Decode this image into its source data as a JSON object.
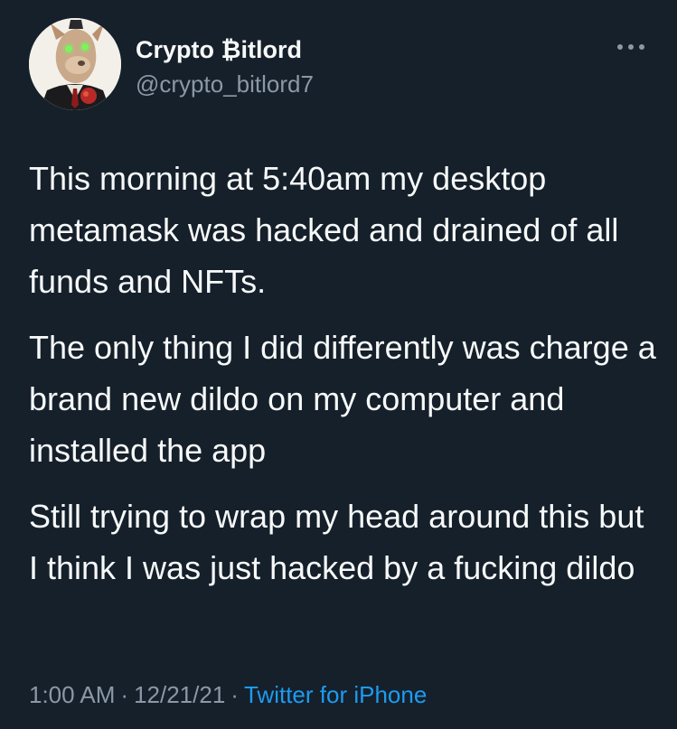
{
  "tweet": {
    "author": {
      "display_name": "Crypto ₿itlord",
      "handle": "@crypto_bitlord7",
      "avatar_icon": "profile-avatar"
    },
    "more_icon": "more-horizontal-icon",
    "paragraphs": [
      "This morning at 5:40am my desktop metamask was hacked and drained of all funds and NFTs.",
      "The only thing I did differently was charge a brand new dildo on my computer and installed the app",
      "Still trying to wrap my head around this but I think I was just hacked by a fucking dildo"
    ],
    "meta": {
      "time": "1:00 AM",
      "separator": "·",
      "date": "12/21/21",
      "source": "Twitter for iPhone"
    }
  },
  "colors": {
    "background": "#15202b",
    "text_primary": "#f7f9f9",
    "text_secondary": "#8b98a5",
    "link": "#1d9bf0"
  }
}
